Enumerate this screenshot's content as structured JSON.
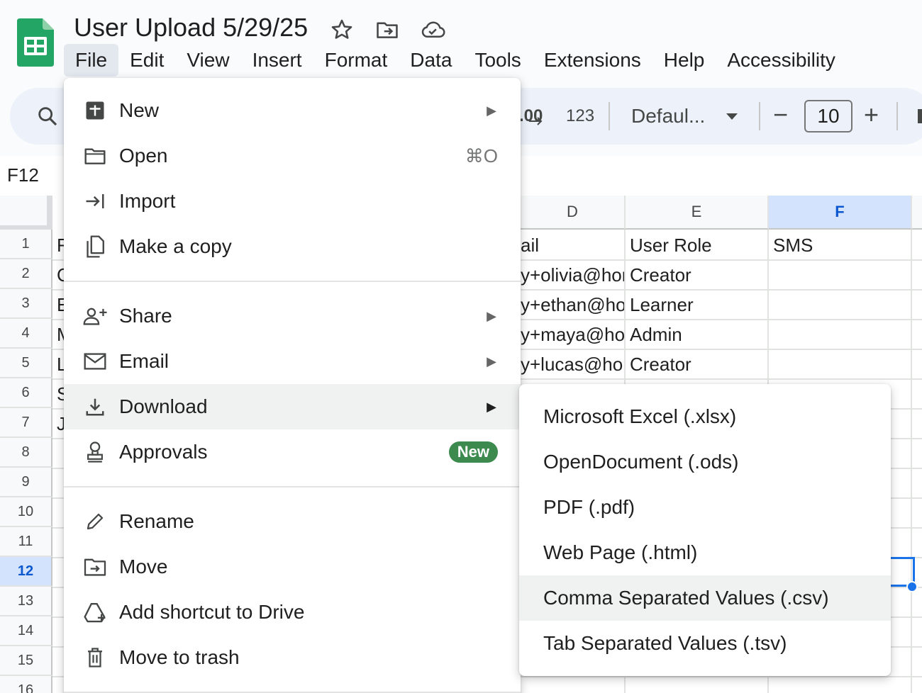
{
  "doc": {
    "title": "User Upload 5/29/25"
  },
  "menubar": [
    "File",
    "Edit",
    "View",
    "Insert",
    "Format",
    "Data",
    "Tools",
    "Extensions",
    "Help",
    "Accessibility"
  ],
  "toolbar": {
    "decimal_label": ".00",
    "number_format_label": "123",
    "font_name": "Defaul...",
    "font_size": "10",
    "minus_label": "−",
    "plus_label": "+"
  },
  "namebox": "F12",
  "grid": {
    "columns": [
      "D",
      "E",
      "F"
    ],
    "selected_column": "F",
    "rows": [
      "1",
      "2",
      "3",
      "4",
      "5",
      "6",
      "7",
      "8",
      "9",
      "10",
      "11",
      "12",
      "13",
      "14",
      "15",
      "16"
    ],
    "selected_row": "12",
    "col_a_visible": [
      "F",
      "C",
      "E",
      "M",
      "L",
      "S",
      "J"
    ],
    "email_fragments": [
      "ail",
      "y+olivia@hor",
      "y+ethan@hoi",
      "y+maya@hoi",
      "y+lucas@hor"
    ],
    "user_roles": [
      "User Role",
      "Creator",
      "Learner",
      "Admin",
      "Creator"
    ],
    "sms_header": "SMS"
  },
  "file_menu": {
    "items": [
      {
        "label": "New",
        "icon": "new-sheet-icon",
        "submenu": true
      },
      {
        "label": "Open",
        "icon": "folder-icon",
        "shortcut": "⌘O"
      },
      {
        "label": "Import",
        "icon": "import-icon"
      },
      {
        "label": "Make a copy",
        "icon": "copy-icon"
      },
      {
        "label": "Share",
        "icon": "person-add-icon",
        "submenu": true
      },
      {
        "label": "Email",
        "icon": "email-icon",
        "submenu": true
      },
      {
        "label": "Download",
        "icon": "download-icon",
        "submenu": true,
        "highlighted": true
      },
      {
        "label": "Approvals",
        "icon": "approvals-icon",
        "badge": "New"
      },
      {
        "label": "Rename",
        "icon": "pencil-icon"
      },
      {
        "label": "Move",
        "icon": "move-folder-icon"
      },
      {
        "label": "Add shortcut to Drive",
        "icon": "drive-shortcut-icon"
      },
      {
        "label": "Move to trash",
        "icon": "trash-icon"
      }
    ]
  },
  "download_submenu": {
    "items": [
      {
        "label": "Microsoft Excel (.xlsx)"
      },
      {
        "label": "OpenDocument (.ods)"
      },
      {
        "label": "PDF (.pdf)"
      },
      {
        "label": "Web Page (.html)"
      },
      {
        "label": "Comma Separated Values (.csv)",
        "highlighted": true
      },
      {
        "label": "Tab Separated Values (.tsv)"
      }
    ]
  },
  "colors": {
    "sheets_green": "#23a566",
    "badge_green": "#3c8a4e",
    "selection_blue": "#1a73e8",
    "header_selected": "#d3e3fd"
  }
}
